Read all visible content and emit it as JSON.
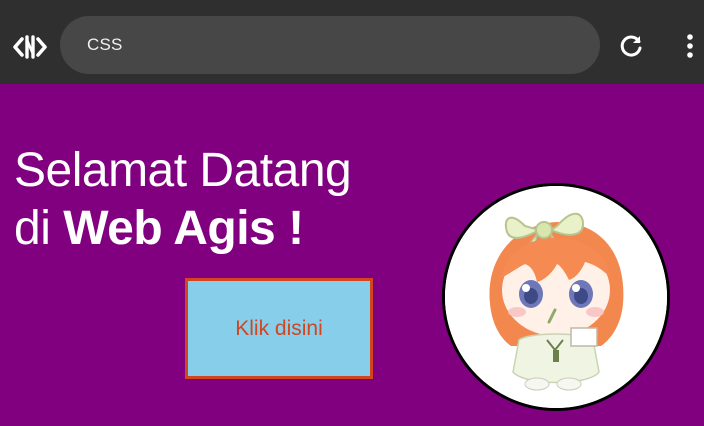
{
  "browser": {
    "address_bar_text": "CSS",
    "logo_icon": "code-brackets-icon",
    "reload_icon": "reload-icon",
    "menu_icon": "more-vertical-icon"
  },
  "page": {
    "greeting_line1": "Selamat Datang",
    "greeting_prefix": "di",
    "brand_name": "Web Agis !",
    "button_label": "Klik disini",
    "avatar_icon": "anime-girl-avatar"
  },
  "colors": {
    "page_background": "#800080",
    "browser_bar": "#2f2f2f",
    "address_bar": "#474747",
    "button_background": "#87ceeb",
    "button_border_text": "#d2451e",
    "avatar_border": "#000000"
  }
}
